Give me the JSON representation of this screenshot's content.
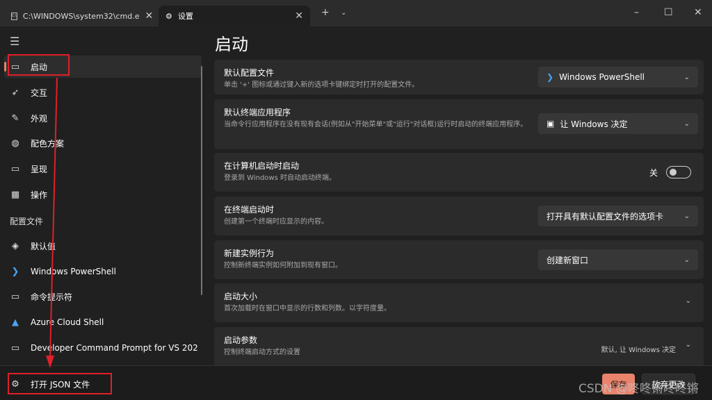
{
  "tabs": [
    {
      "label": "C:\\WINDOWS\\system32\\cmd.e",
      "icon": "cmd-icon"
    },
    {
      "label": "设置",
      "icon": "gear-icon"
    }
  ],
  "page_title": "启动",
  "sidebar": {
    "items": [
      {
        "label": "启动"
      },
      {
        "label": "交互"
      },
      {
        "label": "外观"
      },
      {
        "label": "配色方案"
      },
      {
        "label": "呈现"
      },
      {
        "label": "操作"
      }
    ],
    "section": "配置文件",
    "profiles": [
      {
        "label": "默认值"
      },
      {
        "label": "Windows PowerShell"
      },
      {
        "label": "命令提示符"
      },
      {
        "label": "Azure Cloud Shell"
      },
      {
        "label": "Developer Command Prompt for VS 202"
      }
    ],
    "open_json": "打开 JSON 文件"
  },
  "settings": [
    {
      "title": "默认配置文件",
      "desc": "单击 '+' 图标或通过键入新的选项卡键绑定时打开的配置文件。",
      "value": "Windows PowerShell"
    },
    {
      "title": "默认终端应用程序",
      "desc": "当命令行应用程序在没有现有会话(例如从\"开始菜单\"或\"运行\"对话框)运行时启动的终端应用程序。",
      "value": "让 Windows 决定"
    },
    {
      "title": "在计算机启动时启动",
      "desc": "登录到 Windows 时自动启动终端。",
      "value": "关"
    },
    {
      "title": "在终端启动时",
      "desc": "创建第一个终端时应显示的内容。",
      "value": "打开具有默认配置文件的选项卡"
    },
    {
      "title": "新建实例行为",
      "desc": "控制新终端实例如何附加到现有窗口。",
      "value": "创建新窗口"
    },
    {
      "title": "启动大小",
      "desc": "首次加载时在窗口中显示的行数和列数。以字符度量。"
    },
    {
      "title": "启动参数",
      "desc": "控制终端启动方式的设置",
      "value": "默认, 让 Windows 决定"
    }
  ],
  "buttons": {
    "save": "保存",
    "discard": "放弃更改"
  },
  "watermark": "CSDN @咚咚锵咚咚锵",
  "colors": {
    "accent": "#e9836c",
    "annotation": "#e0202a"
  }
}
